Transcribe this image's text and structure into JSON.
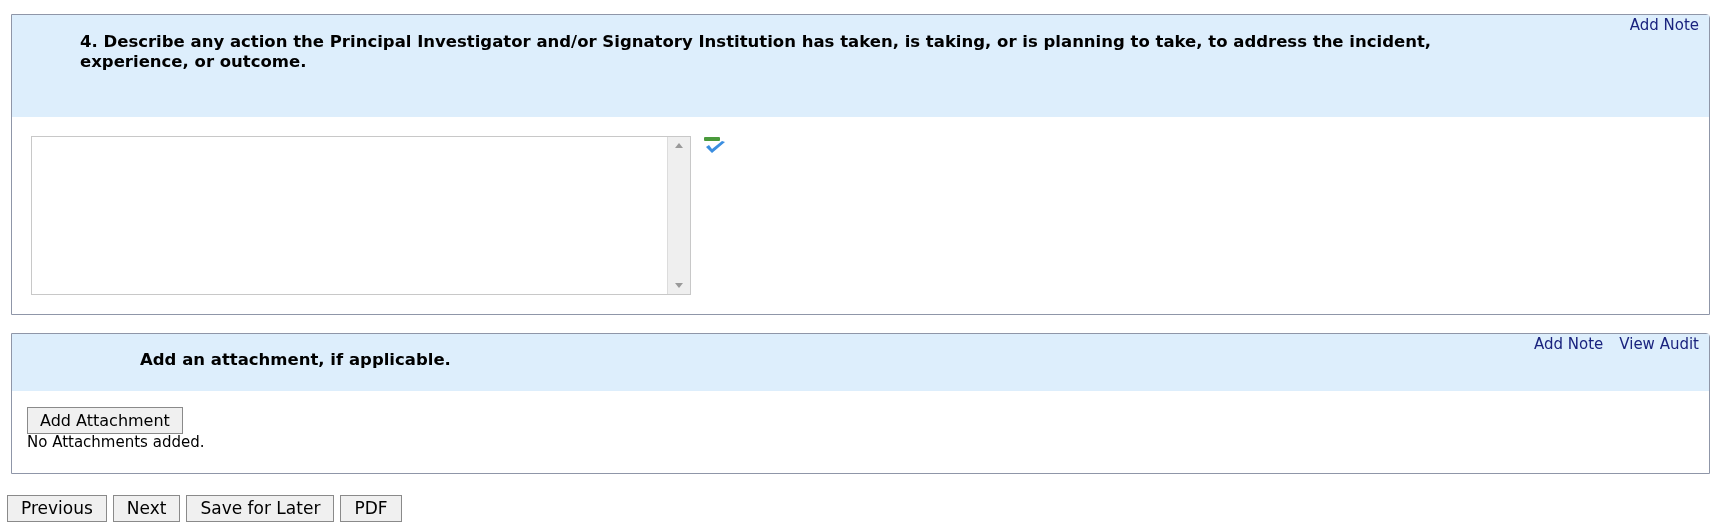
{
  "sections": [
    {
      "title": "4. Describe any action the Principal Investigator and/or Signatory Institution has taken, is taking, or is planning to take, to address the incident, experience, or outcome.",
      "kind": "textarea",
      "links": [
        "Add Note"
      ]
    },
    {
      "title": "Add an attachment, if applicable.",
      "kind": "attachment",
      "links": [
        "Add Note",
        "View Audit"
      ],
      "button": "Add Attachment",
      "status": "No Attachments added."
    }
  ],
  "buttons": [
    "Previous",
    "Next",
    "Save for Later",
    "PDF"
  ]
}
